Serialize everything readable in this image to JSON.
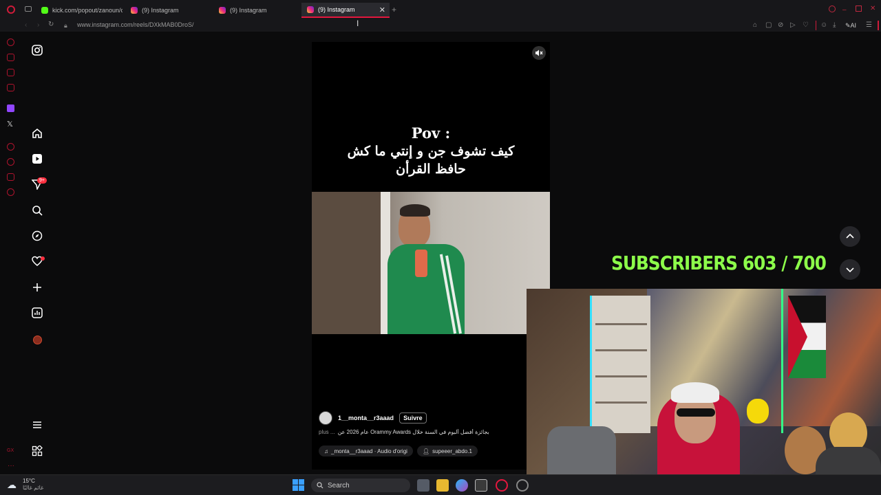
{
  "browser": {
    "tabs": [
      {
        "label": "kick.com/popout/zanoun/c",
        "icon": "kick-icon"
      },
      {
        "label": "(9) Instagram",
        "icon": "instagram-icon"
      },
      {
        "label": "(9) Instagram",
        "icon": "instagram-icon"
      },
      {
        "label": "(9) Instagram",
        "icon": "instagram-icon",
        "active": true
      }
    ],
    "url": "www.instagram.com/reels/DXkMAB0DroS/",
    "ai_label": "AI"
  },
  "sidebar": {
    "notifications_badge": "9+"
  },
  "reel": {
    "caption_pov": "Pov :",
    "caption_line1": "كيف تشوف جن و إنتي ما كش",
    "caption_line2": "حافظ القرأن",
    "username": "1__monta__r3aaad",
    "follow_label": "Suivre",
    "description": "بجائزة أفضل ألبوم في السنة خلال Orammy Awards عام 2026 عن",
    "more_label": "plus ...",
    "audio_label": "_monta__r3aaad · Audio d'origi",
    "tagged_user": "supeeer_abdo.1"
  },
  "overlay": {
    "subscribers_text": "SUBSCRIBERS 603 / 700"
  },
  "taskbar": {
    "temperature": "15°C",
    "weather_label": "غائم غالبًا",
    "search_label": "Search"
  },
  "colors": {
    "accent_opera": "#e5173e",
    "subs_green": "#8dff4a",
    "notif_red": "#ff3040"
  }
}
